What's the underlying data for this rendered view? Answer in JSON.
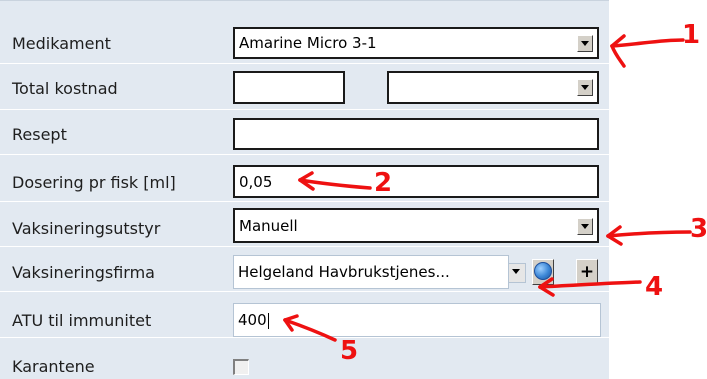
{
  "form": {
    "rows": [
      {
        "label": "Medikament",
        "value": "Amarine Micro 3-1"
      },
      {
        "label": "Total kostnad",
        "value": "",
        "value2": ""
      },
      {
        "label": "Resept",
        "value": ""
      },
      {
        "label": "Dosering pr fisk [ml]",
        "value": "0,05"
      },
      {
        "label": "Vaksineringsutstyr",
        "value": "Manuell"
      },
      {
        "label": "Vaksineringsfirma",
        "value": "Helgeland Havbrukstjenes..."
      },
      {
        "label": "ATU til immunitet",
        "value": "400"
      },
      {
        "label": "Karantene",
        "checked": false
      }
    ]
  },
  "annotations": {
    "labels": [
      "1",
      "2",
      "3",
      "4",
      "5"
    ],
    "color": "#ee1111"
  },
  "icons": {
    "dropdown": "chevron-down-icon",
    "web": "globe-icon",
    "add": "plus-icon",
    "checkbox": "checkbox-icon"
  }
}
